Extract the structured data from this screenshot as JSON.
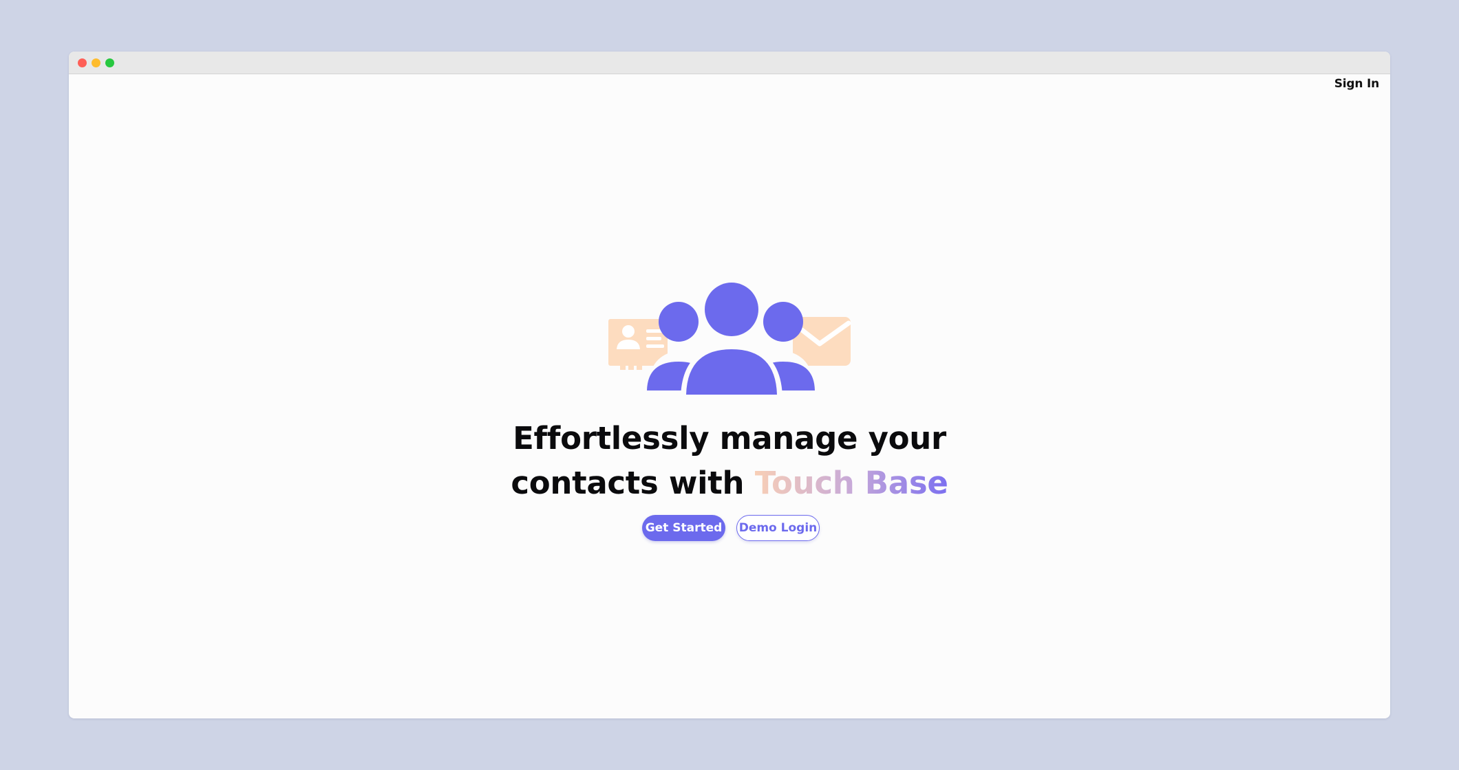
{
  "nav": {
    "sign_in_label": "Sign In"
  },
  "hero": {
    "headline_line1": "Effortlessly manage your",
    "headline_line2_prefix": "contacts with ",
    "brand_name": "Touch Base"
  },
  "actions": {
    "get_started_label": "Get Started",
    "demo_login_label": "Demo Login"
  },
  "colors": {
    "accent": "#6c6aed",
    "peach": "#fddcbf",
    "background": "#ced4e6"
  },
  "icons": {
    "illustration": "contacts-group-icon",
    "card": "contact-card-icon",
    "envelope": "envelope-icon"
  }
}
